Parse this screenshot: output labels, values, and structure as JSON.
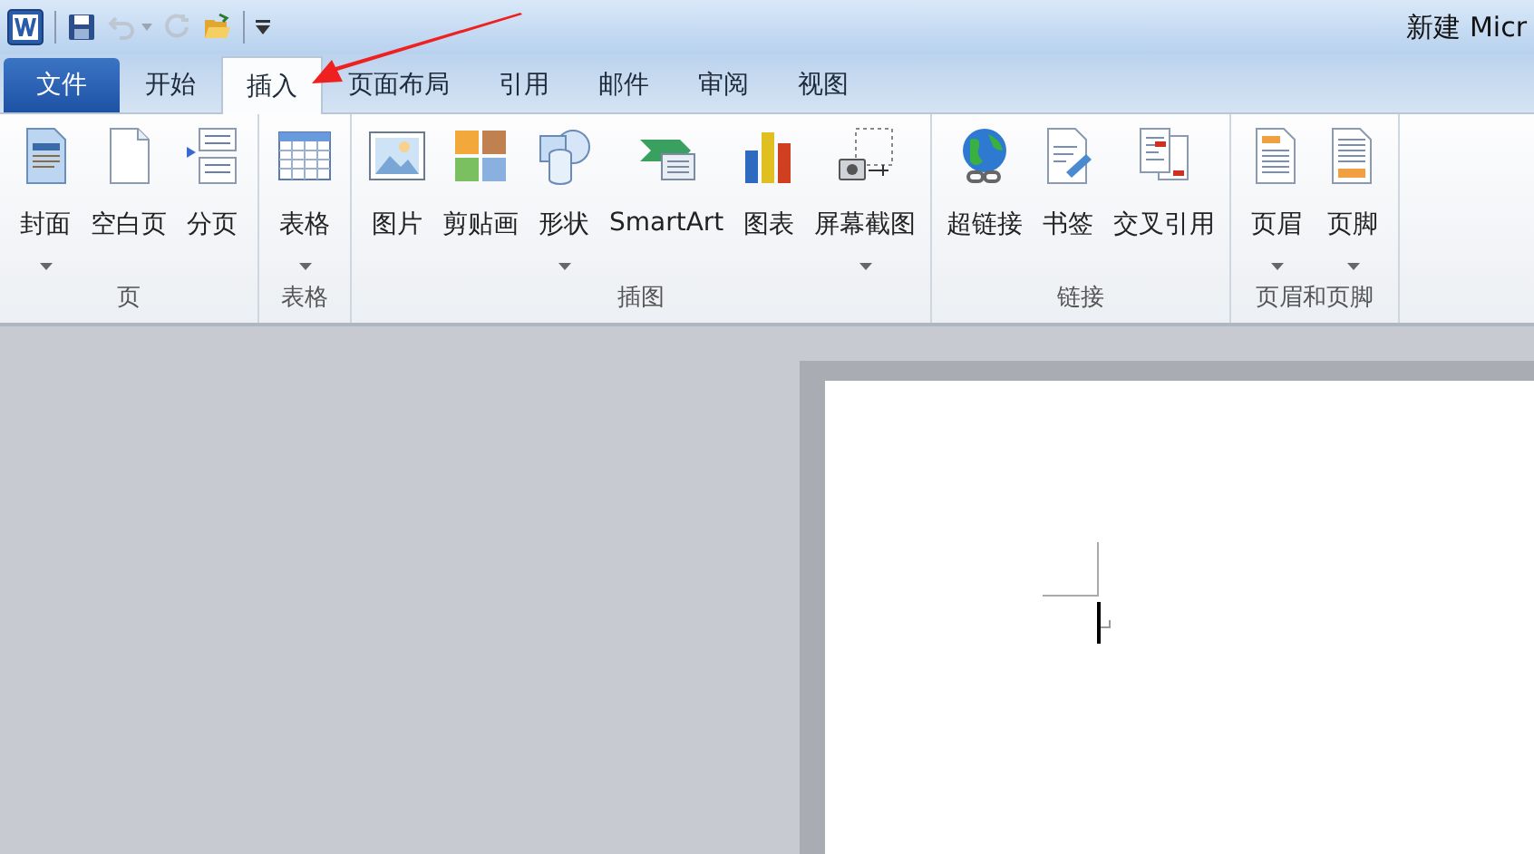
{
  "window": {
    "title": "新建 Micr"
  },
  "quick_access": [
    {
      "kind": "save",
      "disabled": false
    },
    {
      "kind": "undo",
      "disabled": true
    },
    {
      "kind": "redo",
      "disabled": true
    },
    {
      "kind": "open",
      "disabled": false
    }
  ],
  "tabs": [
    {
      "label": "文件",
      "kind": "file",
      "selected": false
    },
    {
      "label": "开始",
      "kind": "tab",
      "selected": false
    },
    {
      "label": "插入",
      "kind": "tab",
      "selected": true
    },
    {
      "label": "页面布局",
      "kind": "tab",
      "selected": false
    },
    {
      "label": "引用",
      "kind": "tab",
      "selected": false
    },
    {
      "label": "邮件",
      "kind": "tab",
      "selected": false
    },
    {
      "label": "审阅",
      "kind": "tab",
      "selected": false
    },
    {
      "label": "视图",
      "kind": "tab",
      "selected": false
    }
  ],
  "ribbon_groups": [
    {
      "label": "页",
      "buttons": [
        {
          "label": "封面",
          "kind": "cover",
          "dropdown": true
        },
        {
          "label": "空白页",
          "kind": "blank",
          "dropdown": false
        },
        {
          "label": "分页",
          "kind": "pagebreak",
          "dropdown": false
        }
      ]
    },
    {
      "label": "表格",
      "buttons": [
        {
          "label": "表格",
          "kind": "table",
          "dropdown": true
        }
      ]
    },
    {
      "label": "插图",
      "buttons": [
        {
          "label": "图片",
          "kind": "picture",
          "dropdown": false
        },
        {
          "label": "剪贴画",
          "kind": "clipart",
          "dropdown": false
        },
        {
          "label": "形状",
          "kind": "shapes",
          "dropdown": true
        },
        {
          "label": "SmartArt",
          "kind": "smartart",
          "dropdown": false
        },
        {
          "label": "图表",
          "kind": "chart",
          "dropdown": false
        },
        {
          "label": "屏幕截图",
          "kind": "screenshot",
          "dropdown": true
        }
      ]
    },
    {
      "label": "链接",
      "buttons": [
        {
          "label": "超链接",
          "kind": "hyperlink",
          "dropdown": false
        },
        {
          "label": "书签",
          "kind": "bookmark",
          "dropdown": false
        },
        {
          "label": "交叉引用",
          "kind": "crossref",
          "dropdown": false
        }
      ]
    },
    {
      "label": "页眉和页脚",
      "buttons": [
        {
          "label": "页眉",
          "kind": "header",
          "dropdown": true
        },
        {
          "label": "页脚",
          "kind": "footer",
          "dropdown": true
        }
      ]
    }
  ]
}
